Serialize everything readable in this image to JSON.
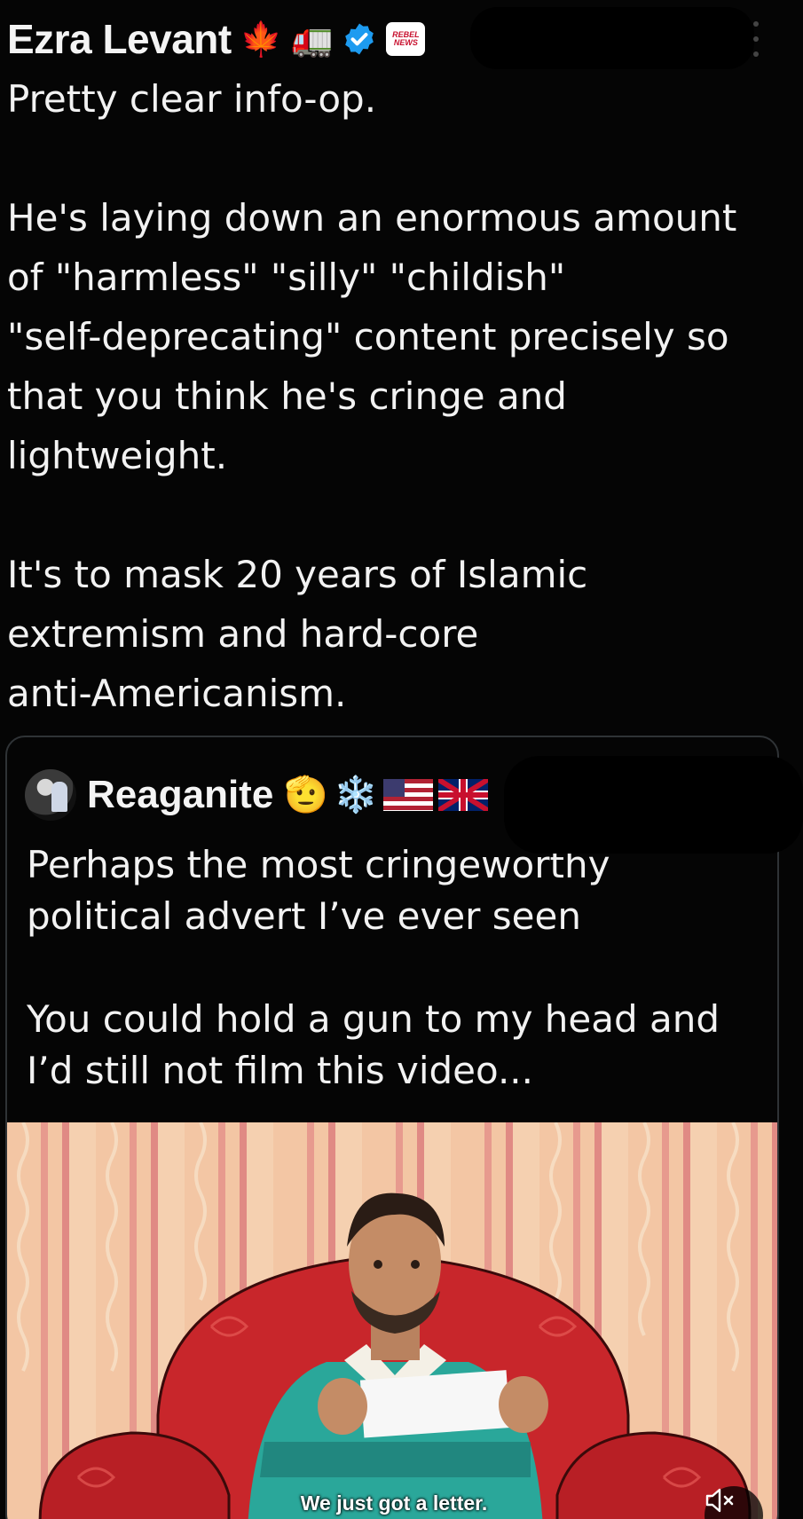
{
  "tweet": {
    "author_name": "Ezra Levant",
    "author_emojis": [
      "🍁",
      "🚛"
    ],
    "verified_icon": "verified-badge-icon",
    "affiliate_badge_text": [
      "REBEL",
      "NEWS"
    ],
    "more_icon": "more-vertical-icon",
    "paragraphs": [
      [
        "Pretty clear info-op."
      ],
      [
        "He's laying down an enormous amount",
        "of \"harmless\" \"silly\" \"childish\"",
        "\"self-deprecating\" content precisely so",
        "that you think he's cringe and",
        "lightweight."
      ],
      [
        "It's to mask 20 years of Islamic",
        "extremism and hard-core",
        "anti-Americanism."
      ]
    ]
  },
  "quote": {
    "author_name": "Reaganite",
    "author_emojis": [
      "🫡",
      "❄️"
    ],
    "flags": [
      "us-flag-icon",
      "uk-flag-icon"
    ],
    "paragraphs": [
      [
        "Perhaps the most cringeworthy",
        "political advert I’ve ever seen"
      ],
      [
        "You could hold a gun to my head and",
        "I’d still not film this video..."
      ]
    ],
    "media": {
      "caption": "We just got a letter.",
      "mute_icon": "volume-muted-icon"
    }
  },
  "colors": {
    "background": "#050505",
    "text": "#f2f2f2",
    "card_border": "#2f3336",
    "verified_blue": "#1d9bf0",
    "chair_red": "#c8262b",
    "wall_peach": "#f3c6a4"
  }
}
